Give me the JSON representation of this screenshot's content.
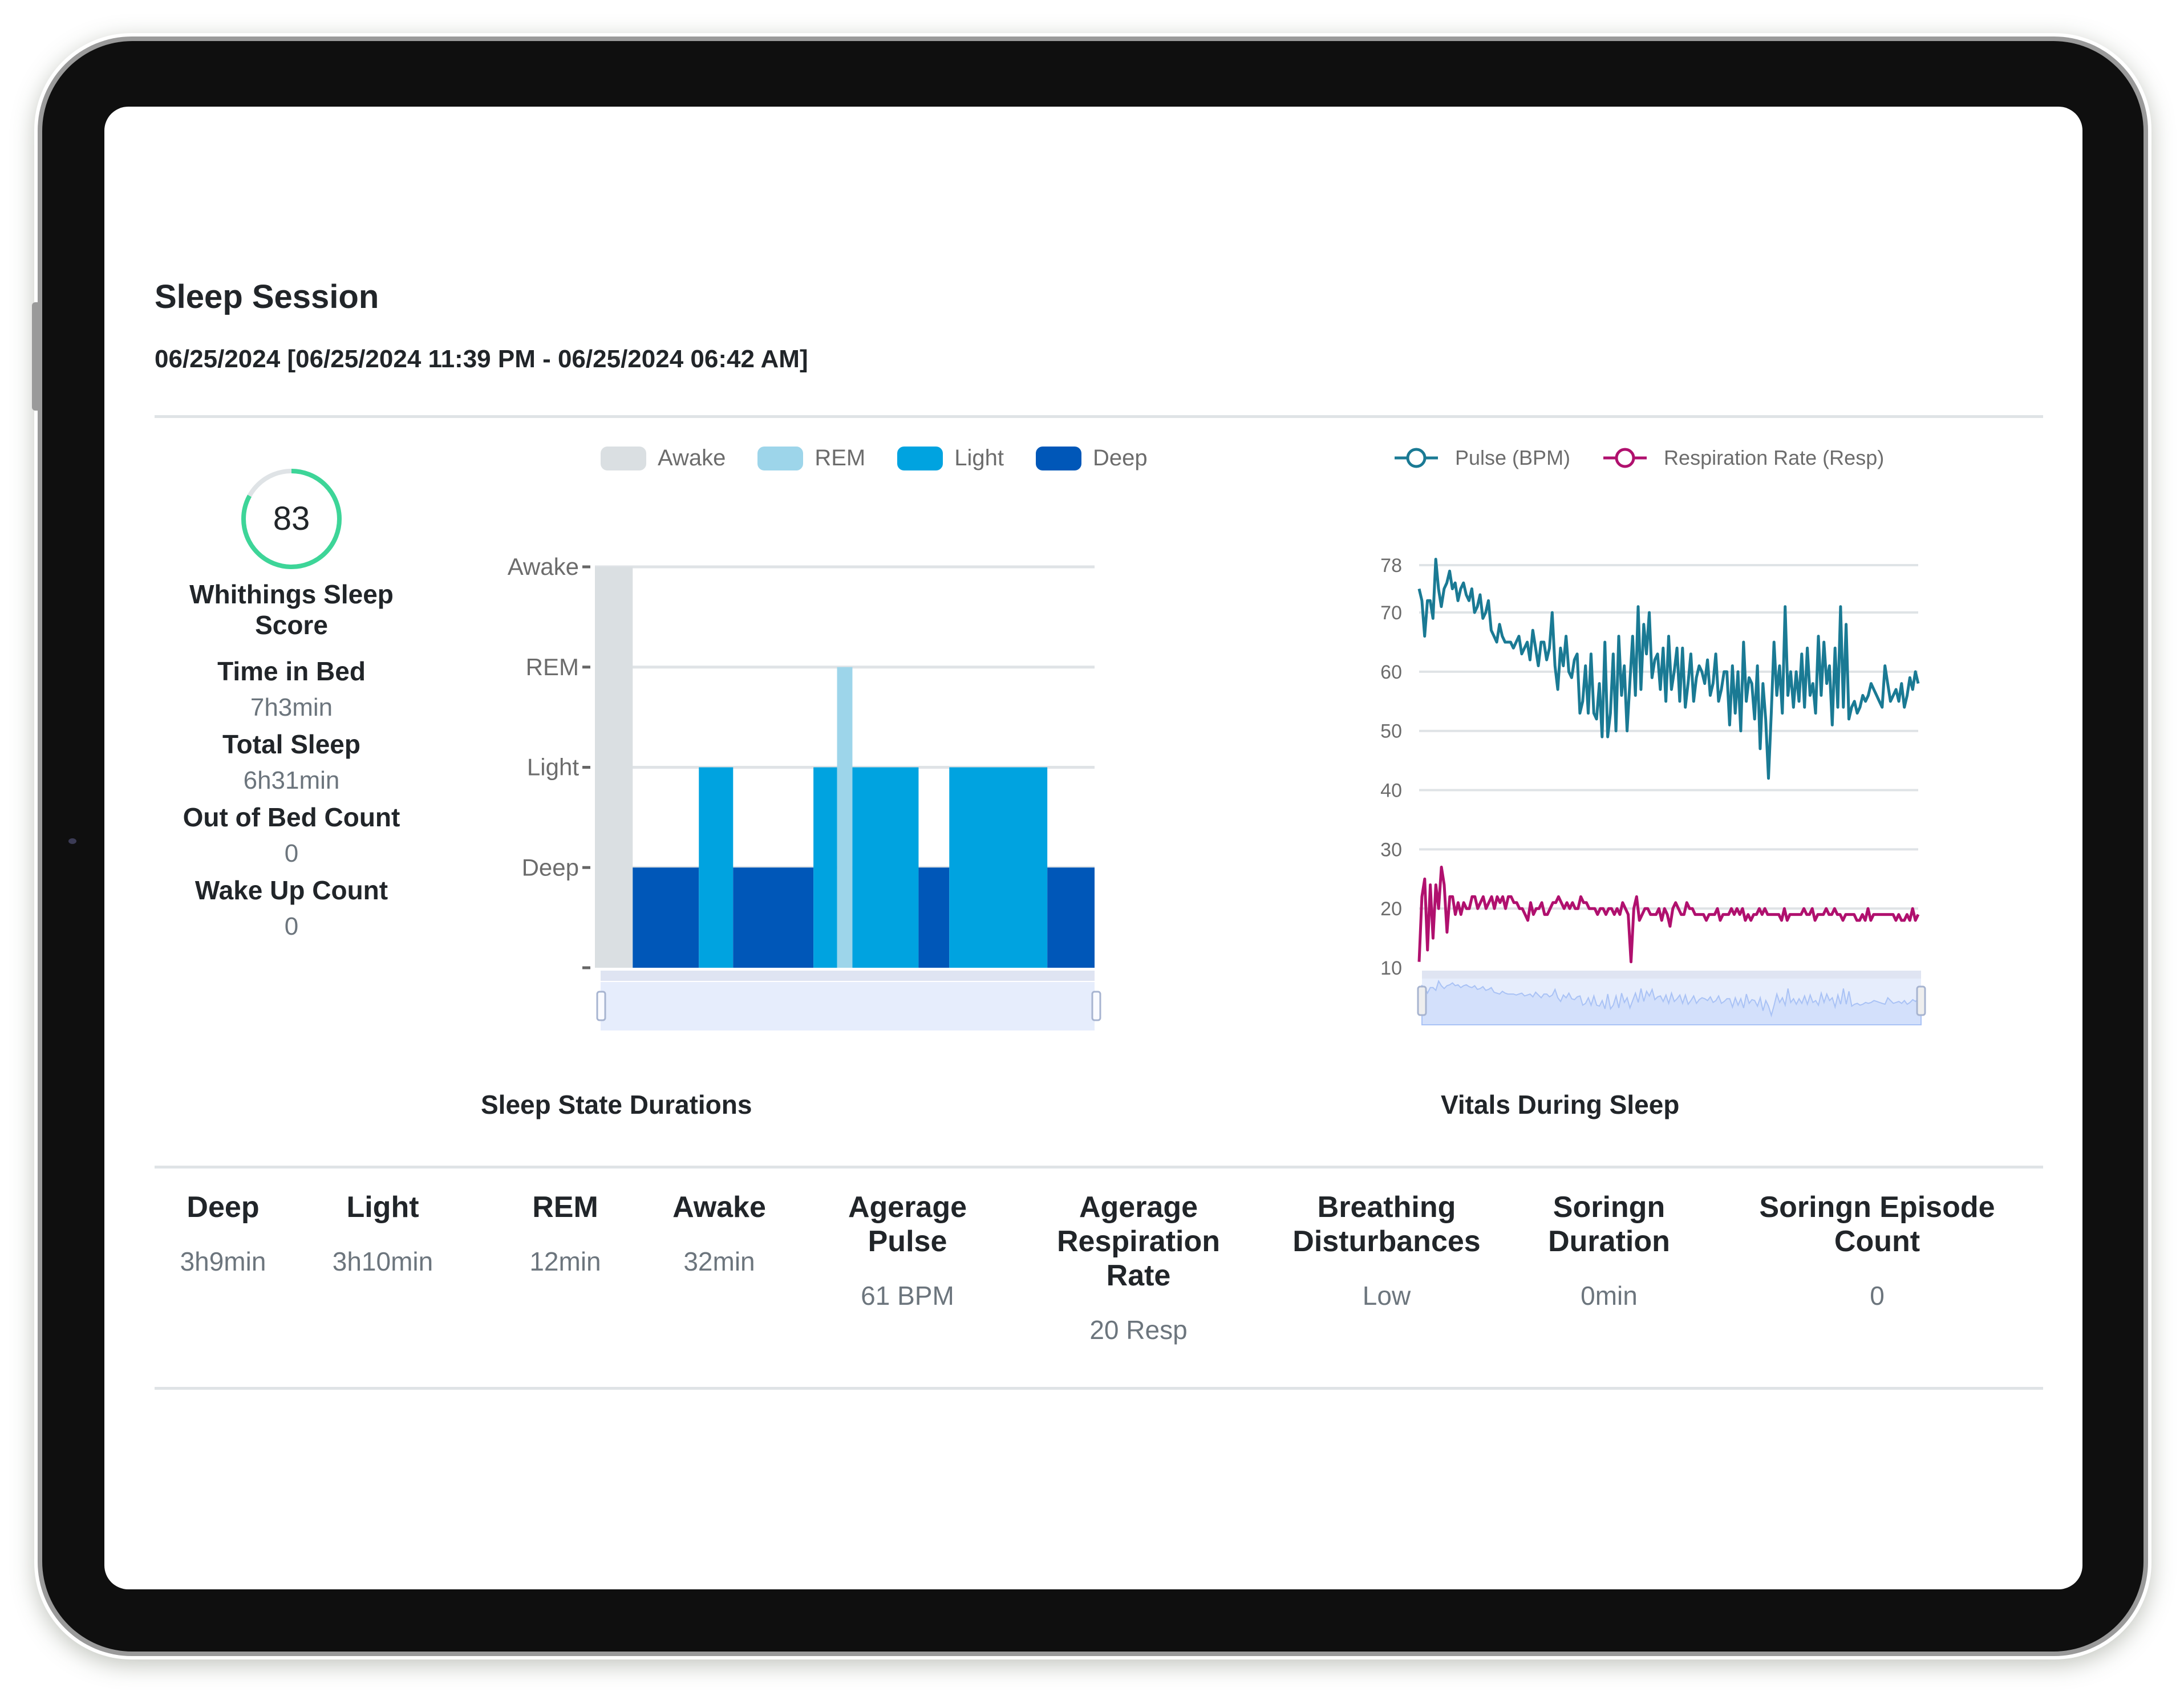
{
  "header": {
    "title": "Sleep Session",
    "subtitle": "06/25/2024 [06/25/2024 11:39 PM - 06/25/2024 06:42 AM]"
  },
  "score": {
    "value": "83",
    "percent": 83,
    "label": "Whithings Sleep Score",
    "ring_color": "#3dd598",
    "track_color": "#dfe3e6"
  },
  "summary": [
    {
      "label": "Time in Bed",
      "value": "7h3min"
    },
    {
      "label": "Total Sleep",
      "value": "6h31min"
    },
    {
      "label": "Out of Bed Count",
      "value": "0"
    },
    {
      "label": "Wake Up Count",
      "value": "0"
    }
  ],
  "chart_data": [
    {
      "type": "bar",
      "title": "Sleep State Durations",
      "legend": [
        {
          "name": "Awake",
          "color": "#dadfe2"
        },
        {
          "name": "REM",
          "color": "#9dd5ea"
        },
        {
          "name": "Light",
          "color": "#00a3e0"
        },
        {
          "name": "Deep",
          "color": "#0057b8"
        }
      ],
      "legend_position": "top",
      "ylabel": "",
      "xlabel": "",
      "y_categories": [
        "Deep",
        "Light",
        "REM",
        "Awake"
      ],
      "x_unit": "minutes from 11:39 PM",
      "x_range": [
        0,
        423
      ],
      "segments": [
        {
          "state": "Awake",
          "start": 0,
          "duration": 32
        },
        {
          "state": "Deep",
          "start": 32,
          "duration": 56
        },
        {
          "state": "Light",
          "start": 88,
          "duration": 29
        },
        {
          "state": "Deep",
          "start": 117,
          "duration": 68
        },
        {
          "state": "Light",
          "start": 185,
          "duration": 20
        },
        {
          "state": "REM",
          "start": 205,
          "duration": 13
        },
        {
          "state": "Light",
          "start": 218,
          "duration": 56
        },
        {
          "state": "Deep",
          "start": 274,
          "duration": 26
        },
        {
          "state": "Light",
          "start": 300,
          "duration": 83
        },
        {
          "state": "Deep",
          "start": 383,
          "duration": 40
        }
      ],
      "grid": true,
      "range_slider": true
    },
    {
      "type": "line",
      "title": "Vitals During Sleep",
      "legend_position": "top",
      "ylim": [
        10,
        78
      ],
      "yticks": [
        10,
        20,
        30,
        40,
        50,
        60,
        70,
        78
      ],
      "grid": true,
      "range_slider": true,
      "series": [
        {
          "name": "Pulse (BPM)",
          "color": "#1a7a94",
          "values": [
            74,
            72,
            66,
            72,
            72,
            69,
            79,
            74,
            71,
            74,
            75,
            77,
            74,
            75,
            72,
            74,
            75,
            73,
            72,
            74,
            70,
            71,
            73,
            69,
            70,
            72,
            67,
            66,
            65,
            68,
            66,
            65,
            65,
            65,
            64,
            65,
            66,
            63,
            64,
            65,
            62,
            67,
            64,
            61,
            65,
            65,
            62,
            64,
            70,
            61,
            57,
            64,
            61,
            66,
            60,
            59,
            62,
            63,
            53,
            55,
            61,
            53,
            63,
            53,
            52,
            58,
            49,
            65,
            49,
            53,
            63,
            50,
            66,
            56,
            61,
            50,
            58,
            66,
            56,
            71,
            57,
            68,
            63,
            70,
            59,
            62,
            63,
            57,
            64,
            55,
            66,
            57,
            60,
            64,
            55,
            64,
            54,
            58,
            63,
            55,
            59,
            61,
            60,
            58,
            62,
            56,
            58,
            63,
            55,
            57,
            60,
            60,
            51,
            61,
            53,
            60,
            50,
            65,
            55,
            59,
            58,
            52,
            61,
            47,
            58,
            52,
            42,
            53,
            65,
            56,
            61,
            53,
            71,
            56,
            60,
            54,
            60,
            55,
            63,
            54,
            64,
            56,
            58,
            53,
            66,
            56,
            65,
            58,
            61,
            51,
            64,
            54,
            71,
            54,
            68,
            52,
            54,
            55,
            53,
            54,
            56,
            55,
            56,
            58,
            57,
            56,
            55,
            54,
            61,
            58,
            55,
            56,
            57,
            55,
            58,
            54,
            56,
            59,
            57,
            60,
            58
          ]
        },
        {
          "name": "Respiration Rate (Resp)",
          "color": "#b0106e",
          "values": [
            11,
            22,
            25,
            13,
            24,
            15,
            24,
            20,
            27,
            24,
            16,
            22,
            22,
            19,
            21,
            19,
            21,
            20,
            20,
            22,
            22,
            20,
            21,
            22,
            20,
            21,
            22,
            20,
            22,
            21,
            22,
            20,
            22,
            22,
            21,
            21,
            20,
            20,
            19,
            18,
            21,
            19,
            20,
            20,
            21,
            19,
            19,
            20,
            21,
            21,
            22,
            21,
            20,
            21,
            20,
            21,
            20,
            20,
            22,
            21,
            21,
            20,
            20,
            20,
            19,
            20,
            20,
            19,
            20,
            20,
            19,
            20,
            19,
            21,
            20,
            19,
            11,
            20,
            22,
            18,
            19,
            20,
            20,
            19,
            19,
            19,
            20,
            18,
            20,
            19,
            17,
            20,
            21,
            20,
            19,
            19,
            21,
            20,
            20,
            19,
            19,
            19,
            19,
            18,
            19,
            19,
            19,
            20,
            18,
            19,
            19,
            19,
            20,
            19,
            20,
            19,
            20,
            18,
            19,
            18,
            19,
            19,
            20,
            19,
            20,
            19,
            19,
            19,
            19,
            19,
            18,
            20,
            18,
            19,
            19,
            19,
            19,
            19,
            20,
            19,
            19,
            20,
            18,
            19,
            19,
            19,
            20,
            19,
            19,
            20,
            19,
            19,
            18,
            19,
            19,
            19,
            19,
            18,
            18,
            19,
            18,
            20,
            18,
            19,
            19,
            19,
            19,
            19,
            19,
            19,
            19,
            18,
            19,
            18,
            18,
            19,
            18,
            20,
            18,
            19
          ]
        }
      ]
    }
  ],
  "charts_titles": {
    "sleep": "Sleep State Durations",
    "vitals": "Vitals During Sleep"
  },
  "bottom_stats": [
    {
      "label": "Deep",
      "value": "3h9min"
    },
    {
      "label": "Light",
      "value": "3h10min"
    },
    {
      "label": "REM",
      "value": "12min"
    },
    {
      "label": "Awake",
      "value": "32min"
    },
    {
      "label": "Agerage Pulse",
      "value": "61 BPM"
    },
    {
      "label": "Agerage Respiration Rate",
      "value": "20 Resp"
    },
    {
      "label": "Breathing Disturbances",
      "value": "Low"
    },
    {
      "label": "Soringn Duration",
      "value": "0min"
    },
    {
      "label": "Soringn Episode Count",
      "value": "0"
    }
  ]
}
